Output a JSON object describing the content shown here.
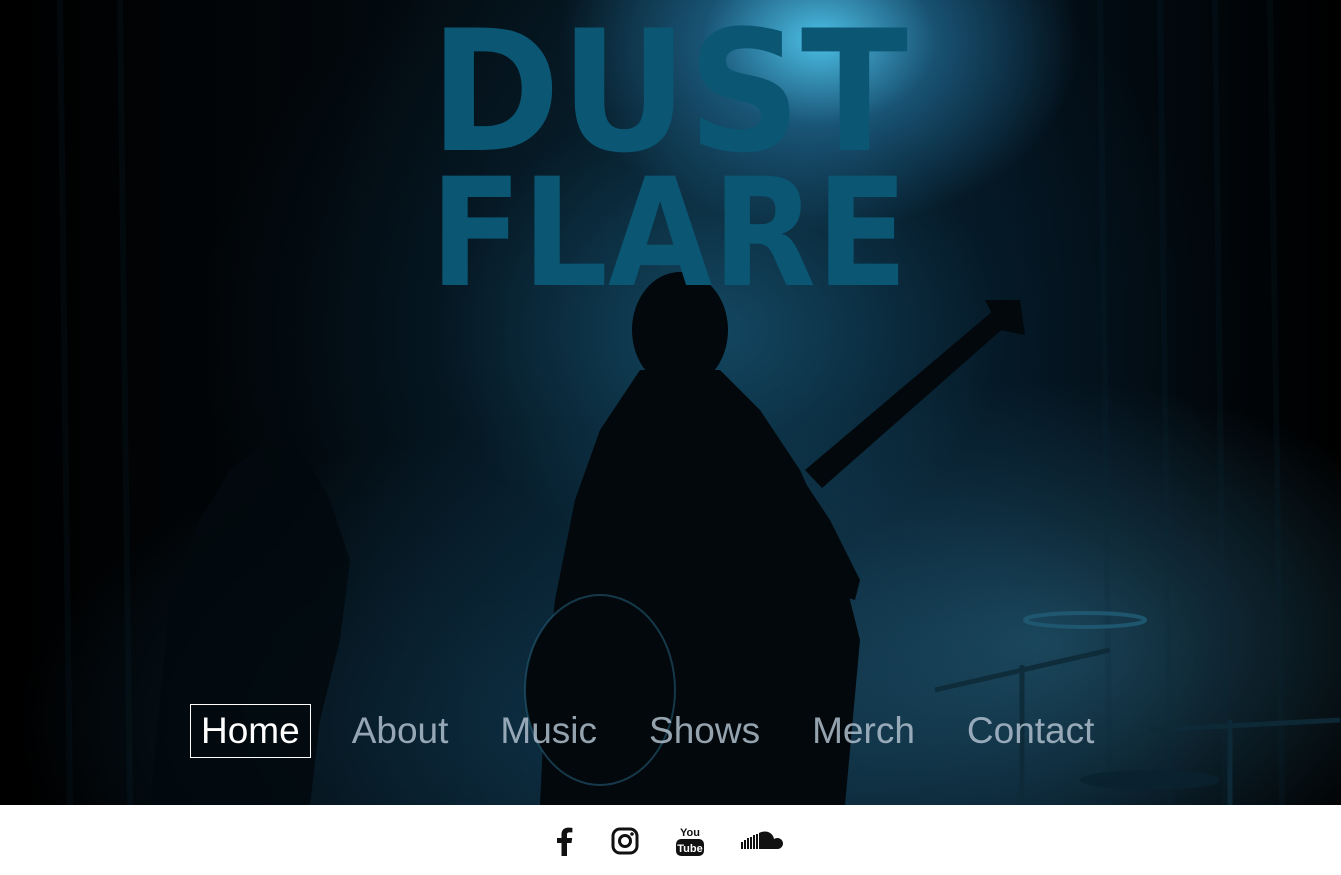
{
  "logo": {
    "line1": "DUST",
    "line2": "FLARE",
    "color": "#0a5673"
  },
  "nav": {
    "items": [
      {
        "label": "Home",
        "active": true
      },
      {
        "label": "About",
        "active": false
      },
      {
        "label": "Music",
        "active": false
      },
      {
        "label": "Shows",
        "active": false
      },
      {
        "label": "Merch",
        "active": false
      },
      {
        "label": "Contact",
        "active": false
      }
    ]
  },
  "social": {
    "icons": [
      "facebook-icon",
      "instagram-icon",
      "youtube-icon",
      "soundcloud-icon"
    ],
    "youtube_text_top": "You",
    "youtube_text_bottom": "Tube"
  },
  "colors": {
    "accent": "#0a5673",
    "stage_light": "#50c8f0",
    "nav_inactive": "#afbecd",
    "nav_active": "#ffffff"
  }
}
